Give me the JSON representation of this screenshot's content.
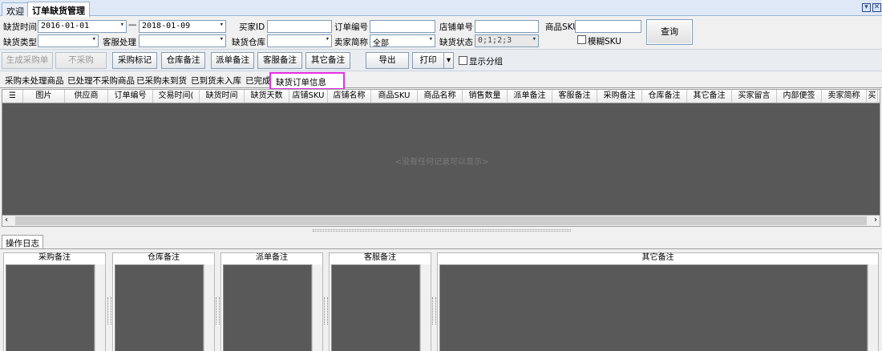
{
  "tabs": [
    {
      "label": "欢迎"
    },
    {
      "label": "订单缺货管理"
    }
  ],
  "window_buttons": {
    "dropdown": "▾",
    "close": "✕"
  },
  "filters": {
    "shortage_time_label": "缺货时间",
    "date_from": "2016-01-01",
    "date_sep": "—",
    "date_to": "2018-01-09",
    "buyer_id_label": "买家ID",
    "buyer_id_value": "",
    "order_no_label": "订单编号",
    "order_no_value": "",
    "store_order_label": "店铺单号",
    "store_order_value": "",
    "sku_label": "商品SKU",
    "sku_value": "",
    "fuzzy_sku_label": "模糊SKU",
    "shortage_type_label": "缺货类型",
    "shortage_type_value": "",
    "cs_handle_label": "客服处理",
    "cs_handle_value": "",
    "warehouse_label": "缺货仓库",
    "warehouse_value": "",
    "seller_short_label": "卖家简称",
    "seller_short_value": "全部",
    "shortage_status_label": "缺货状态",
    "shortage_status_value": "0;1;2;3",
    "query_button": "查询"
  },
  "toolbar": {
    "gen_purchase": "生成采购单",
    "no_purchase": "不采购",
    "purchase_mark": "采购标记",
    "warehouse_note": "仓库备注",
    "dispatch_note": "派单备注",
    "cs_note": "客服备注",
    "other_note": "其它备注",
    "export": "导出",
    "print": "打印",
    "print_arrow": "▾",
    "show_group": "显示分组"
  },
  "subtabs": [
    {
      "label": "采购未处理商品"
    },
    {
      "label": "已处理不采购商品"
    },
    {
      "label": "已采购未到货"
    },
    {
      "label": "已到货未入库"
    },
    {
      "label": "已完成"
    },
    {
      "label": "缺货订单信息"
    }
  ],
  "grid": {
    "menu_icon": "☰",
    "columns": [
      "图片",
      "供应商",
      "订单编号",
      "交易时间(",
      "缺货时间",
      "缺货天数",
      "店铺SKU",
      "店铺名称",
      "商品SKU",
      "商品名称",
      "销售数量",
      "派单备注",
      "客服备注",
      "采购备注",
      "仓库备注",
      "其它备注",
      "买家留言",
      "内部便签",
      "卖家简称",
      "买"
    ],
    "empty_message": "<没有任何记录可以显示>"
  },
  "log": {
    "tab_label": "操作日志",
    "panels": [
      {
        "title": "采购备注"
      },
      {
        "title": "仓库备注"
      },
      {
        "title": "派单备注"
      },
      {
        "title": "客服备注"
      },
      {
        "title": "其它备注"
      }
    ]
  },
  "colors": {
    "highlight_border": "#e62ee6",
    "grid_bg": "#585858"
  }
}
